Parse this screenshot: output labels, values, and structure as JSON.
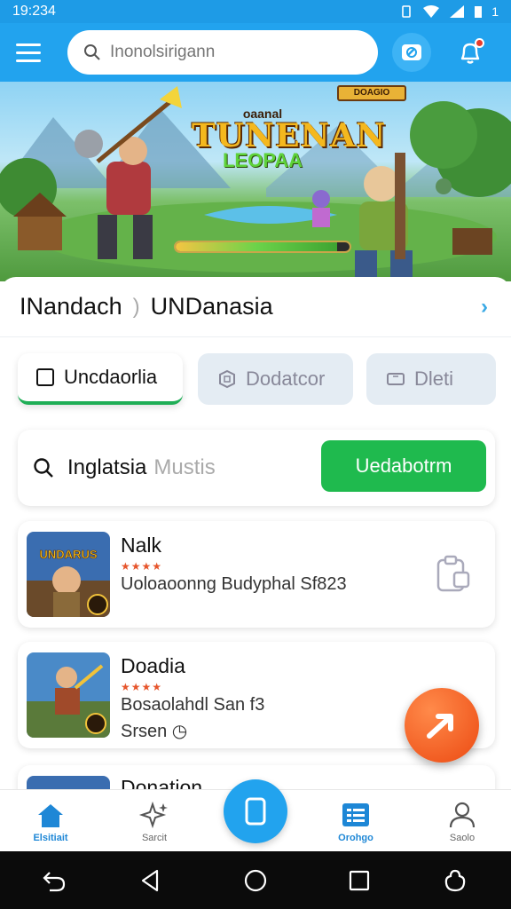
{
  "status_bar": {
    "time": "19:234",
    "battery_text": "1"
  },
  "header": {
    "search_placeholder": "Inonolsirigann"
  },
  "hero": {
    "subtitle": "oaanal",
    "title": "TUNENAN",
    "tagline": "LEOPAA",
    "badge": "DOAGIO",
    "progress_percent": 93
  },
  "section": {
    "left_label": "INandach",
    "divider": ")",
    "right_label": "UNDanasia"
  },
  "tabs": [
    {
      "label": "Uncdaorlia",
      "active": true
    },
    {
      "label": "Dodatcor",
      "active": false
    },
    {
      "label": "Dleti",
      "active": false
    }
  ],
  "search_panel": {
    "query": "Inglatsia",
    "hint": "Mustis",
    "button_label": "Uedabotrm"
  },
  "items": [
    {
      "name": "Nalk",
      "rating": 4,
      "thumb_label": "UNDARUS",
      "description": "Uoloaoonng Budyphal Sf823"
    },
    {
      "name": "Doadia",
      "rating": 4,
      "description": "Bosaolahdl San f3",
      "subtext": "Srsen"
    },
    {
      "name": "Donation",
      "partial": true
    }
  ],
  "bottom_nav": [
    {
      "label": "Elsitiait",
      "icon": "home-icon"
    },
    {
      "label": "Sarcit",
      "icon": "sparkle-icon"
    },
    {
      "label": "",
      "icon": "tablet-icon"
    },
    {
      "label": "Orohgo",
      "icon": "list-icon"
    },
    {
      "label": "Saolo",
      "icon": "person-icon"
    }
  ],
  "colors": {
    "primary": "#22a3ee",
    "accent_green": "#1fba4e",
    "fab_orange": "#ec4a12",
    "star": "#e6552c"
  }
}
